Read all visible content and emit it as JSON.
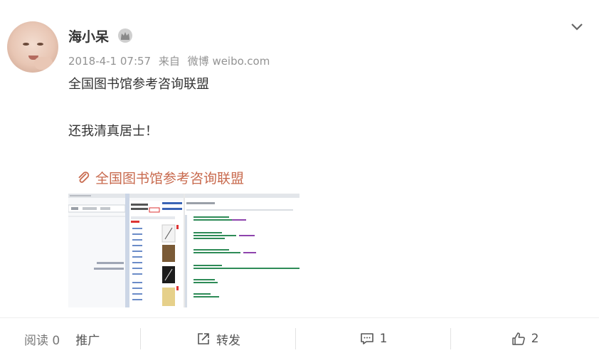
{
  "post": {
    "username": "海小呆",
    "timestamp": "2018-4-1 07:57",
    "source_prefix": "来自",
    "source_app": "微博 weibo.com",
    "text_lines": [
      "全国图书馆参考咨询联盟",
      "还我清真居士！"
    ],
    "link_text": "全国图书馆参考咨询联盟",
    "icons": {
      "verified": "crown-icon",
      "menu": "chevron-down-icon",
      "link": "paperclip-link-icon",
      "repost": "repost-icon",
      "comment": "comment-icon",
      "like": "thumbs-up-icon"
    }
  },
  "footer": {
    "read_label": "阅读 0",
    "promote_label": "推广",
    "repost_label": "转发",
    "comment_count": "1",
    "like_count": "2"
  },
  "colors": {
    "link": "#c86a4e",
    "text": "#333333",
    "meta": "#939393"
  }
}
